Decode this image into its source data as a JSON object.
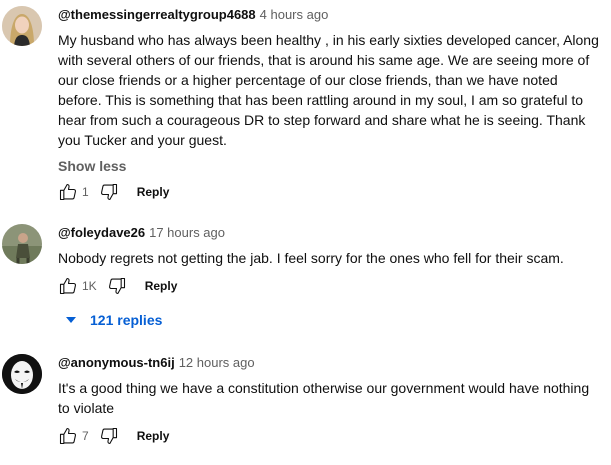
{
  "comments": [
    {
      "author": "@themessingerrealtygroup4688",
      "time": "4 hours ago",
      "text": "My husband who has always been healthy , in his early sixties developed cancer, Along with several others of our friends, that is around his same age. We are seeing more of our close friends or a higher percentage of our close friends, than we have noted before. This is something that has been rattling around in my soul, I am so grateful to hear from such a courageous DR to step forward and share what he is seeing. Thank you Tucker and your guest.",
      "show_less": "Show less",
      "likes": "1",
      "reply": "Reply"
    },
    {
      "author": "@foleydave26",
      "time": "17 hours ago",
      "text": "Nobody regrets not getting the jab. I feel sorry for the ones who fell for their scam.",
      "likes": "1K",
      "reply": "Reply",
      "replies_label": "121 replies"
    },
    {
      "author": "@anonymous-tn6ij",
      "time": "12 hours ago",
      "text": "It's a good thing we have a constitution otherwise our government would have nothing to violate",
      "likes": "7",
      "reply": "Reply"
    }
  ],
  "icons": {
    "like": "thumb-up-icon",
    "dislike": "thumb-down-icon",
    "caret": "caret-down-icon"
  }
}
